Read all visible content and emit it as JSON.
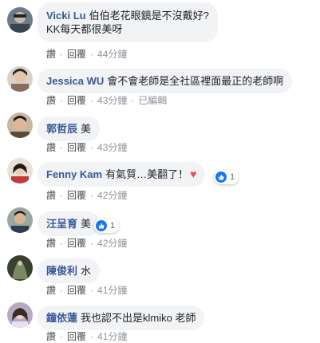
{
  "actions": {
    "like": "讚",
    "reply": "回覆"
  },
  "comments": [
    {
      "author": "Vicki Lu",
      "line1": "伯伯老花眼鏡是不沒戴好?",
      "line2": "KK每天都很美呀",
      "time": "44分鐘"
    },
    {
      "author": "Jessica WU",
      "text": "會不會老師是全社區裡面最正的老師啊",
      "time": "43分鐘",
      "edited": "已編輯"
    },
    {
      "author": "郭哲辰",
      "text": "美",
      "time": "43分鐘"
    },
    {
      "author": "Fenny Kam",
      "text": "有氣質…美翻了！",
      "heart": "♥",
      "reactions": "1",
      "time": "42分鐘"
    },
    {
      "author": "汪呈育",
      "text": "美",
      "reactions": "1",
      "time": "42分鐘"
    },
    {
      "author": "陳俊利",
      "text": "水",
      "time": "41分鐘"
    },
    {
      "author": "鐘依蓮",
      "text": "我也認不出是klmiko 老師",
      "time": "41分鐘"
    }
  ],
  "colors": {
    "author": "#385898",
    "bubble": "#f2f3f5",
    "like_badge": "#1877f2",
    "heart": "#e64a5c"
  }
}
